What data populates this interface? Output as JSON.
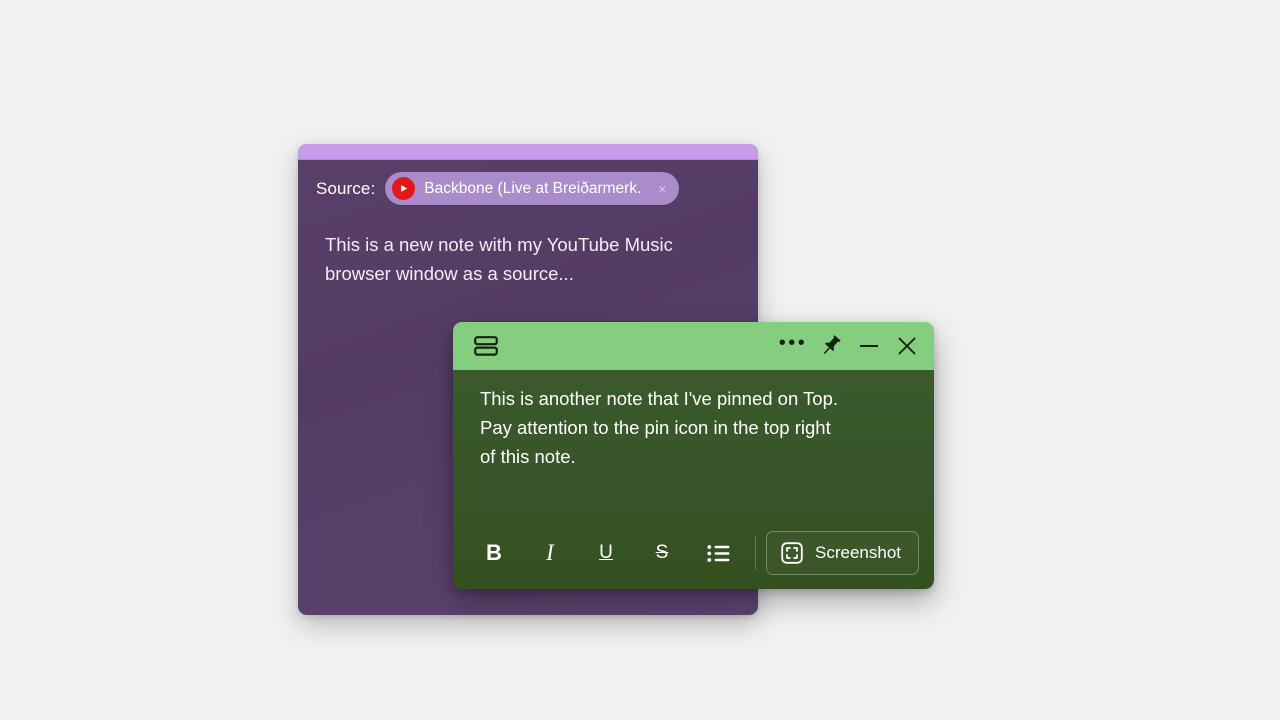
{
  "purple_note": {
    "source_label": "Source:",
    "source_chip": {
      "icon": "youtube-play-icon",
      "title": "Backbone (Live at Breiðarmerk...",
      "close_icon": "×"
    },
    "body_text": "This is a new note with my YouTube Music\nbrowser window as a source...",
    "colors": {
      "titlebar": "#c79cec",
      "body": "#553c64",
      "chip": "#a98cc9",
      "youtube_red": "#e01a1a"
    }
  },
  "green_note": {
    "titlebar": {
      "notes_list_icon": "notes-list-icon",
      "more_label": "•••",
      "pin_icon": "pin-icon",
      "pin_state": "pinned",
      "minimize_icon": "minimize-icon",
      "close_icon": "close-icon"
    },
    "body_text": "This is another note that I've pinned on Top.\nPay attention to the pin icon in the top right\nof this note.",
    "toolbar": {
      "bold_label": "B",
      "italic_label": "I",
      "underline_label": "U",
      "strikethrough_label": "S",
      "bullet_list_icon": "bullet-list-icon",
      "screenshot_label": "Screenshot",
      "screenshot_icon": "screen-capture-icon"
    },
    "colors": {
      "titlebar": "#85cd7f",
      "body": "#375428",
      "text": "#ffffff"
    }
  },
  "background": {
    "color": "#f1f1f1"
  }
}
